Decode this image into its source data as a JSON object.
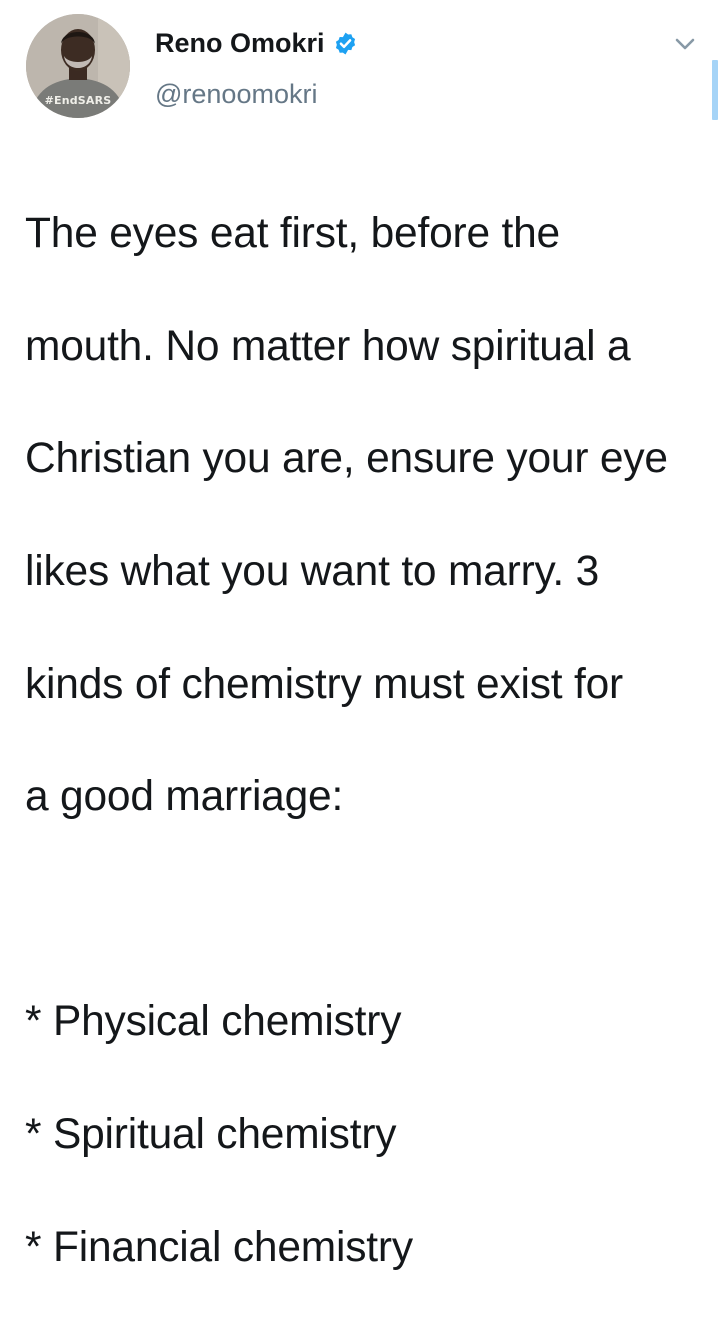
{
  "author": {
    "display_name": "Reno Omokri",
    "handle": "@renoomokri",
    "verified": true,
    "avatar_shirt_text": "#EndSARS"
  },
  "icons": {
    "verified": "verified-badge-icon",
    "menu": "chevron-down-icon"
  },
  "tweet": {
    "lines": [
      "The eyes eat first, before the",
      "mouth. No matter how spiritual a",
      "Christian you are, ensure your eye",
      "likes what you want to marry. 3",
      "kinds of chemistry must exist for",
      "a good marriage:",
      "",
      "* Physical chemistry",
      "* Spiritual chemistry",
      "* Financial chemistry"
    ]
  },
  "colors": {
    "verified_blue": "#1da1f2",
    "secondary_text": "#657786",
    "primary_text": "#14171a"
  }
}
